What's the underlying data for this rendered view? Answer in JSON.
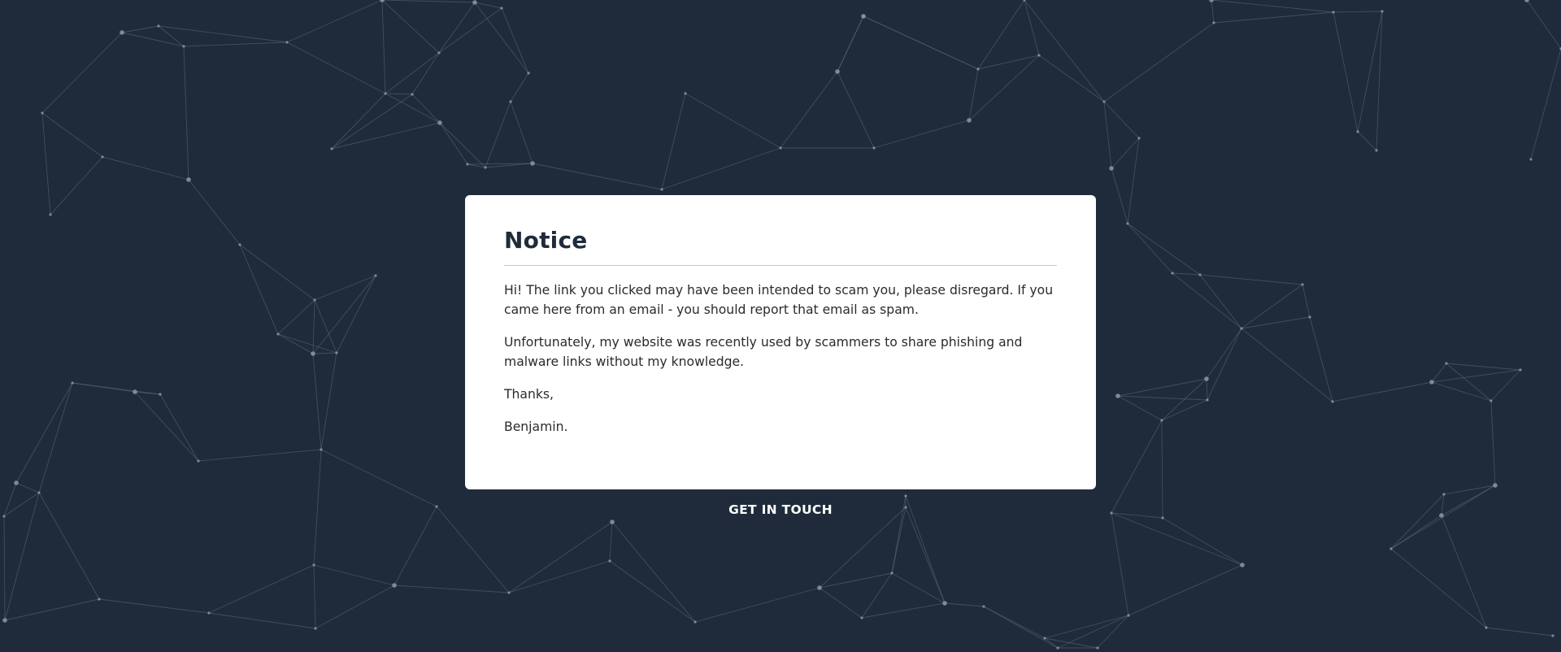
{
  "notice": {
    "title": "Notice",
    "paragraphs": [
      "Hi! The link you clicked may have been intended to scam you, please disregard. If you came here from an email - you should report that email as spam.",
      "Unfortunately, my website was recently used by scammers to share phishing and malware links without my knowledge.",
      "Thanks,",
      "Benjamin."
    ]
  },
  "footer": {
    "cta_label": "GET IN TOUCH"
  },
  "colors": {
    "background": "#1f2b3a",
    "card": "#ffffff",
    "network_lines": "#5b6b7e",
    "network_nodes": "#8a98a8"
  }
}
